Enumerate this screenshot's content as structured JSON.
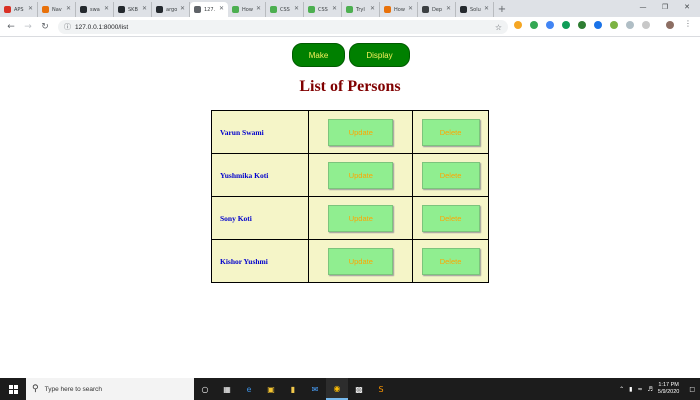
{
  "browser": {
    "tabs": [
      {
        "label": "APS",
        "icon": "gmail-icon",
        "color": "#d93025"
      },
      {
        "label": "Nav",
        "icon": "page-icon",
        "color": "#e8710a"
      },
      {
        "label": "swa",
        "icon": "github-icon",
        "color": "#24292e"
      },
      {
        "label": "SKB",
        "icon": "github-icon",
        "color": "#24292e"
      },
      {
        "label": "argo",
        "icon": "github-icon",
        "color": "#24292e"
      },
      {
        "label": "127.",
        "icon": "globe-icon",
        "color": "#5f6368",
        "active": true
      },
      {
        "label": "How",
        "icon": "w3schools-icon",
        "color": "#4caf50"
      },
      {
        "label": "CSS",
        "icon": "w3schools-icon",
        "color": "#4caf50"
      },
      {
        "label": "CSS",
        "icon": "w3schools-icon",
        "color": "#4caf50"
      },
      {
        "label": "TryI",
        "icon": "w3schools-icon",
        "color": "#4caf50"
      },
      {
        "label": "How",
        "icon": "page-icon",
        "color": "#e8710a"
      },
      {
        "label": "Dep",
        "icon": "book-icon",
        "color": "#3c4043"
      },
      {
        "label": "Solu",
        "icon": "github-icon",
        "color": "#24292e"
      }
    ],
    "new_tab": "+",
    "url": "127.0.0.1:8000/list"
  },
  "page": {
    "make_label": "Make",
    "display_label": "Display",
    "title": "List of Persons",
    "persons": [
      {
        "name": "Varun Swami",
        "update": "Update",
        "delete": "Delete"
      },
      {
        "name": "Yushmika Koti",
        "update": "Update",
        "delete": "Delete"
      },
      {
        "name": "Sony Koti",
        "update": "Update",
        "delete": "Delete"
      },
      {
        "name": "Kishor Yushmi",
        "update": "Update",
        "delete": "Delete"
      }
    ]
  },
  "taskbar": {
    "search_placeholder": "Type here to search",
    "time": "1:17 PM",
    "date": "5/9/2020"
  },
  "colors": {
    "button_green": "#008000",
    "button_text_yellow": "#f5f05a",
    "title_maroon": "#800000",
    "table_bg": "#f5f5c8",
    "name_blue": "#0000cd",
    "row_button_bg": "#90ee90",
    "row_button_text": "#ffa500"
  }
}
